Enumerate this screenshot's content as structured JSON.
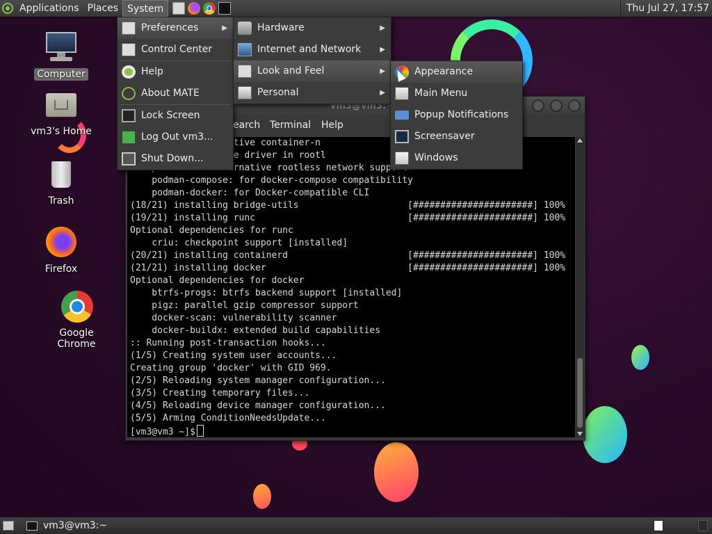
{
  "top_panel": {
    "menus": [
      "Applications",
      "Places",
      "System"
    ],
    "clock": "Thu Jul 27, 17:57"
  },
  "desktop_icons": [
    {
      "label": "Computer",
      "icon": "computer-icon"
    },
    {
      "label": "vm3's Home",
      "icon": "home-folder-icon"
    },
    {
      "label": "Trash",
      "icon": "trash-icon"
    },
    {
      "label": "Firefox",
      "icon": "firefox-icon"
    },
    {
      "label": "Google Chrome",
      "icon": "chrome-icon"
    }
  ],
  "system_menu": {
    "items": [
      "Preferences",
      "Control Center",
      "Help",
      "About MATE",
      "Lock Screen",
      "Log Out vm3...",
      "Shut Down..."
    ]
  },
  "preferences_menu": {
    "items": [
      "Hardware",
      "Internet and Network",
      "Look and Feel",
      "Personal"
    ]
  },
  "look_and_feel_menu": {
    "items": [
      "Appearance",
      "Main Menu",
      "Popup Notifications",
      "Screensaver",
      "Windows"
    ]
  },
  "terminal": {
    "title": "vm3@vm3:~",
    "menus": [
      "earch",
      "Terminal",
      "Help"
    ],
    "lines": [
      "       r an alternative container-n                         ction",
      "         for storage driver in rootl",
      "    passt: for alternative rootless network support",
      "    podman-compose: for docker-compose compatibility",
      "    podman-docker: for Docker-compatible CLI",
      "(18/21) installing bridge-utils                    [######################] 100%",
      "(19/21) installing runc                            [######################] 100%",
      "Optional dependencies for runc",
      "    criu: checkpoint support [installed]",
      "(20/21) installing containerd                      [######################] 100%",
      "(21/21) installing docker                          [######################] 100%",
      "Optional dependencies for docker",
      "    btrfs-progs: btrfs backend support [installed]",
      "    pigz: parallel gzip compressor support",
      "    docker-scan: vulnerability scanner",
      "    docker-buildx: extended build capabilities",
      ":: Running post-transaction hooks...",
      "(1/5) Creating system user accounts...",
      "Creating group 'docker' with GID 969.",
      "(2/5) Reloading system manager configuration...",
      "(3/5) Creating temporary files...",
      "(4/5) Reloading device manager configuration...",
      "(5/5) Arming ConditionNeedsUpdate..."
    ],
    "prompt": "[vm3@vm3 ~]$"
  },
  "bottom_panel": {
    "task": "vm3@vm3:~"
  },
  "colors": {
    "accent_blob_orange": "#ff6a3d",
    "accent_blob_cyan": "#29c6ff"
  }
}
